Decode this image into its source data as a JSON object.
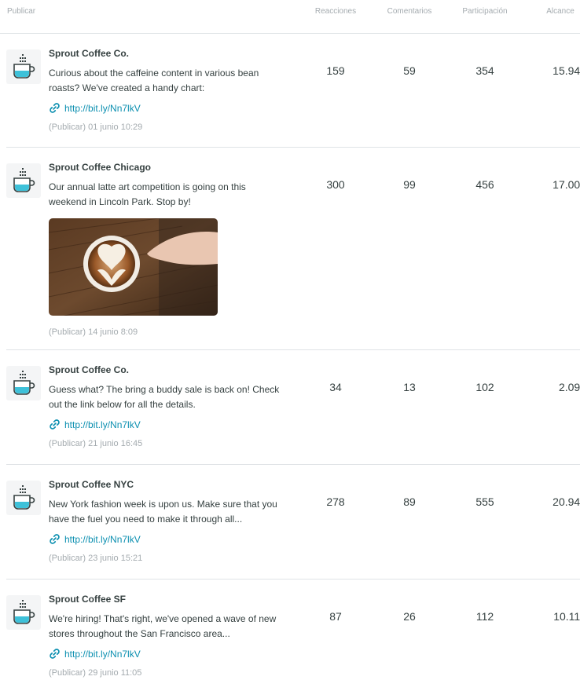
{
  "header": {
    "post": "Publicar",
    "reactions": "Reacciones",
    "comments": "Comentarios",
    "engagement": "Participación",
    "reach": "Alcance"
  },
  "icon": "coffee-cup-icon",
  "rows": [
    {
      "name": "Sprout Coffee Co.",
      "text": "Curious about the caffeine content in various bean roasts? We've created a handy chart:",
      "link": "http://bit.ly/Nn7lkV",
      "meta": "(Publicar) 01 junio 10:29",
      "reactions": "159",
      "comments": "59",
      "engagement": "354",
      "reach": "15.947"
    },
    {
      "name": "Sprout Coffee Chicago",
      "text": "Our annual latte art competition is going on this weekend in Lincoln Park. Stop by!",
      "image": "latte-art-photo",
      "meta": "(Publicar) 14 junio 8:09",
      "reactions": "300",
      "comments": "99",
      "engagement": "456",
      "reach": "17.002"
    },
    {
      "name": "Sprout Coffee Co.",
      "text": "Guess what? The bring a buddy sale is back on! Check out the link below for all the details.",
      "link": "http://bit.ly/Nn7lkV",
      "meta": "(Publicar) 21 junio 16:45",
      "reactions": "34",
      "comments": "13",
      "engagement": "102",
      "reach": "2.097"
    },
    {
      "name": "Sprout Coffee NYC",
      "text": "New York fashion week is upon us. Make sure that you have the fuel you need to make it through all...",
      "link": "http://bit.ly/Nn7lkV",
      "meta": "(Publicar) 23 junio 15:21",
      "reactions": "278",
      "comments": "89",
      "engagement": "555",
      "reach": "20.947"
    },
    {
      "name": "Sprout Coffee SF",
      "text": "We're hiring! That's right, we've opened a wave of new stores throughout the San Francisco area...",
      "link": "http://bit.ly/Nn7lkV",
      "meta": "(Publicar) 29 junio 11:05",
      "reactions": "87",
      "comments": "26",
      "engagement": "112",
      "reach": "10.113"
    }
  ]
}
